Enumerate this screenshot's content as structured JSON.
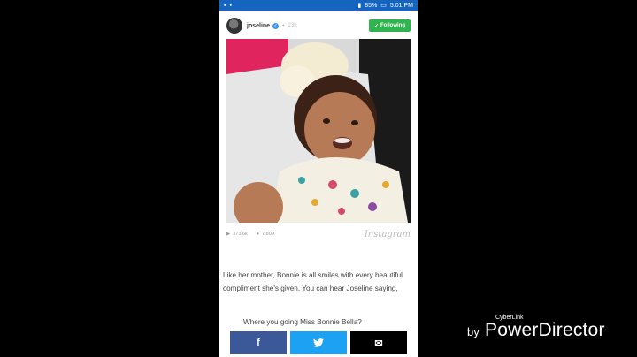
{
  "statusbar": {
    "battery": "85%",
    "time": "5:01 PM"
  },
  "post": {
    "username": "joseline",
    "time": "23h",
    "follow_label": "Following",
    "views": "373.6k",
    "comments": "7,809",
    "brand": "Instagram"
  },
  "article": {
    "caption": "Like her mother, Bonnie is all smiles with every beautiful compliment she's given. You can hear Joseline saying,",
    "quote": "Where you going Miss Bonnie Bella?"
  },
  "share": {
    "facebook": "f",
    "email": "✉"
  },
  "watermark": {
    "brand_small": "CyberLink",
    "by": "by",
    "product": "PowerDirector"
  }
}
